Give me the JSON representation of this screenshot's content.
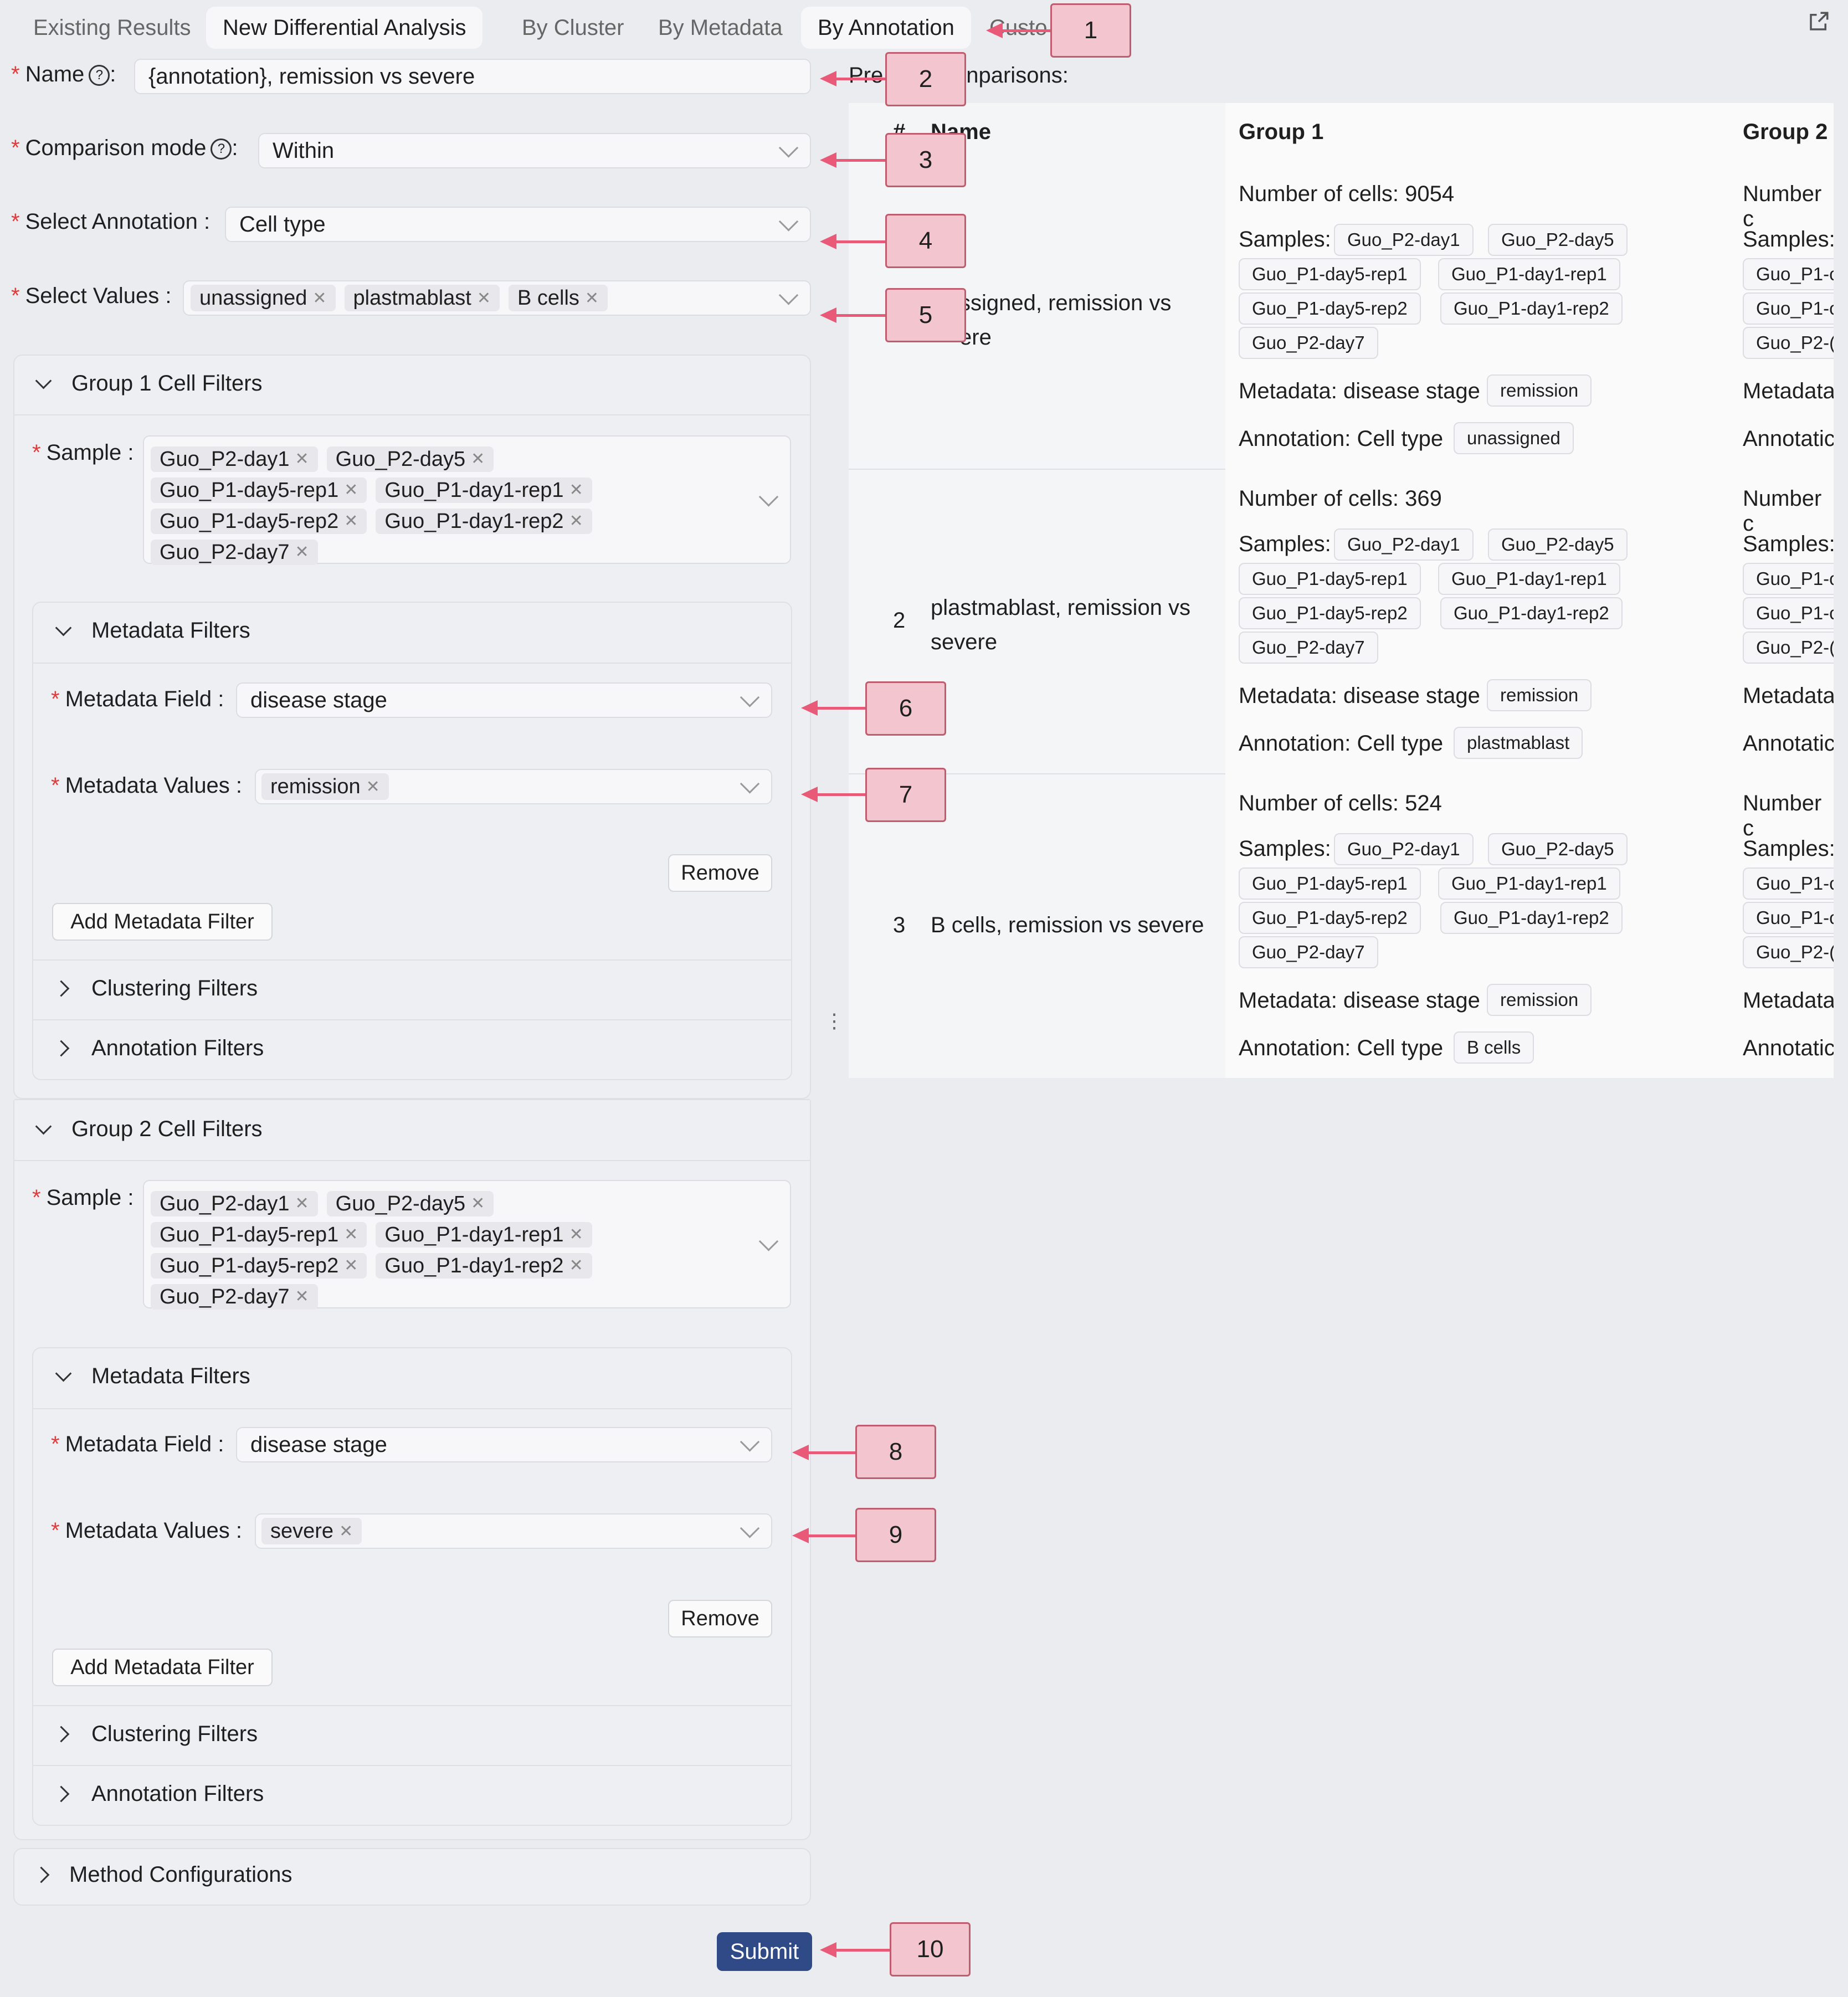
{
  "tabs": [
    "Existing Results",
    "New Differential Analysis",
    "By Cluster",
    "By Metadata",
    "By Annotation",
    "Custo"
  ],
  "form": {
    "name_label": "Name",
    "name_value": "{annotation}, remission vs severe",
    "mode_label": "Comparison mode",
    "mode_value": "Within",
    "annotation_label": "Select Annotation",
    "annotation_value": "Cell type",
    "values_label": "Select Values",
    "values": [
      "unassigned",
      "plastmablast",
      "B cells"
    ]
  },
  "group1": {
    "title": "Group 1 Cell Filters",
    "sample_label": "Sample",
    "samples": [
      "Guo_P2-day1",
      "Guo_P2-day5",
      "Guo_P1-day5-rep1",
      "Guo_P1-day1-rep1",
      "Guo_P1-day5-rep2",
      "Guo_P1-day1-rep2",
      "Guo_P2-day7"
    ],
    "metadata_title": "Metadata Filters",
    "field_label": "Metadata Field",
    "field_value": "disease stage",
    "values_label": "Metadata Values",
    "value": "remission",
    "remove": "Remove",
    "add": "Add Metadata Filter",
    "clustering": "Clustering Filters",
    "annotation": "Annotation Filters"
  },
  "group2": {
    "title": "Group 2 Cell Filters",
    "sample_label": "Sample",
    "samples": [
      "Guo_P2-day1",
      "Guo_P2-day5",
      "Guo_P1-day5-rep1",
      "Guo_P1-day1-rep1",
      "Guo_P1-day5-rep2",
      "Guo_P1-day1-rep2",
      "Guo_P2-day7"
    ],
    "metadata_title": "Metadata Filters",
    "field_label": "Metadata Field",
    "field_value": "disease stage",
    "values_label": "Metadata Values",
    "value": "severe",
    "remove": "Remove",
    "add": "Add Metadata Filter",
    "clustering": "Clustering Filters",
    "annotation": "Annotation Filters"
  },
  "method": "Method Configurations",
  "submit": "Submit",
  "preview": {
    "title_a": "Pre",
    "title_b": "nparisons:",
    "headers": [
      "#",
      "Name",
      "Group 1",
      "Group 2"
    ],
    "rows": [
      {
        "idx": "",
        "name1": "ssigned, remission vs",
        "name2": "ere",
        "cells": "Number of cells: 9054",
        "meta": "Metadata: disease stage",
        "meta_tag": "remission",
        "ann": "Annotation: Cell type",
        "ann_tag": "unassigned"
      },
      {
        "idx": "2",
        "name1": "plastmablast, remission vs",
        "name2": "severe",
        "cells": "Number of cells: 369",
        "meta": "Metadata: disease stage",
        "meta_tag": "remission",
        "ann": "Annotation: Cell type",
        "ann_tag": "plastmablast"
      },
      {
        "idx": "3",
        "name1": "B cells, remission vs severe",
        "name2": "",
        "cells": "Number of cells: 524",
        "meta": "Metadata: disease stage",
        "meta_tag": "remission",
        "ann": "Annotation: Cell type",
        "ann_tag": "B cells"
      }
    ],
    "samples_label": "Samples:",
    "sample_tags": [
      "Guo_P2-day1",
      "Guo_P2-day5",
      "Guo_P1-day5-rep1",
      "Guo_P1-day1-rep1",
      "Guo_P1-day5-rep2",
      "Guo_P1-day1-rep2",
      "Guo_P2-day7"
    ],
    "g2_cells": "Number c",
    "g2_samples": "Samples:",
    "g2_tag_a": "Guo_P1-c",
    "g2_tag_b": "Guo_P2-(",
    "g2_meta": "Metadata",
    "g2_ann": "Annotatic"
  },
  "callouts": [
    "1",
    "2",
    "3",
    "4",
    "5",
    "6",
    "7",
    "8",
    "9",
    "10"
  ],
  "colors": {
    "accent": "#2f4a86",
    "required": "#e03c3c",
    "callout_fill": "#f3c5ce",
    "arrow": "#e85a78"
  },
  "icons": [
    "external-link-icon",
    "help-icon",
    "chevron-down-icon",
    "chevron-right-icon",
    "close-icon",
    "drag-handle-icon"
  ]
}
